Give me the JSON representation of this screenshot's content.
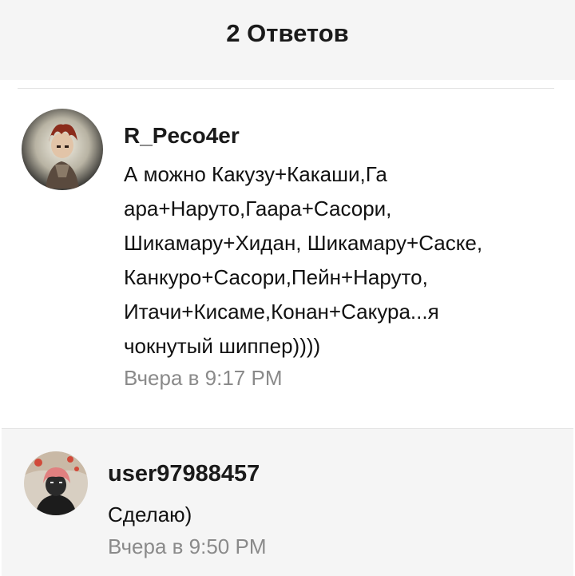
{
  "header": {
    "title": "2 Ответов"
  },
  "comments": [
    {
      "username": "R_Peco4er",
      "avatar": "avatar-red-hair-character",
      "text_lines": [
        "А можно Какузу+Какаши,Га",
        "ара+Наруто,Гаара+Сасори,",
        "Шикамару+Хидан, Шикамару+Саске,",
        "Канкуро+Сасори,Пейн+Наруто,",
        "Итачи+Кисаме,Конан+Сакура...я",
        "чокнутый шиппер))))"
      ],
      "time": "Вчера в 9:17 PM"
    },
    {
      "username": "user97988457",
      "avatar": "avatar-pink-hair-character",
      "text_lines": [
        "Сделаю)"
      ],
      "time": "Вчера в 9:50 PM"
    }
  ],
  "colors": {
    "header_bg": "#f5f5f5",
    "timestamp": "#8a8a8a",
    "reply_bg": "#f5f5f5"
  }
}
